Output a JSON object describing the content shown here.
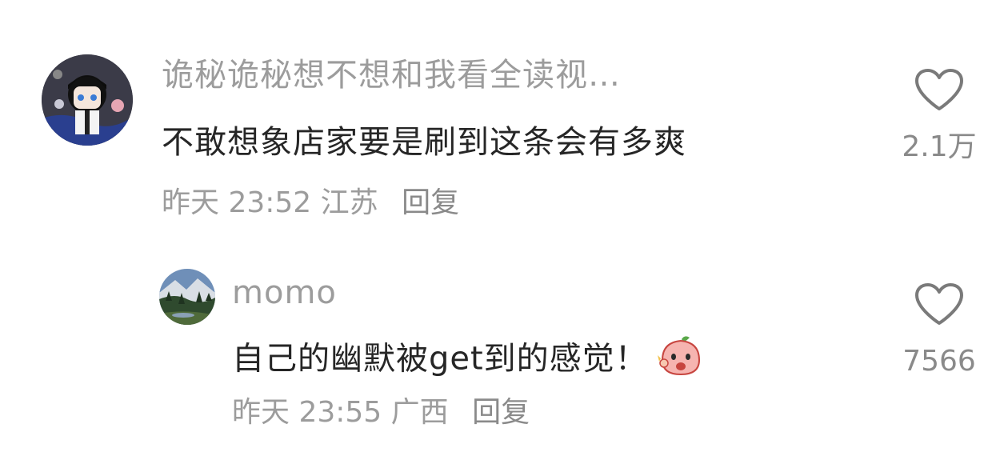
{
  "comments": [
    {
      "username": "诡秘诡秘想不想和我看全读视…",
      "content": "不敢想象店家要是刷到这条会有多爽",
      "time": "昨天 23:52",
      "location": "江苏",
      "reply_label": "回复",
      "like_count": "2.1万",
      "avatar_icon": "anime-character-avatar",
      "like_icon": "heart-outline-icon"
    },
    {
      "username": "momo",
      "content": "自己的幽默被get到的感觉！",
      "time": "昨天 23:55",
      "location": "广西",
      "reply_label": "回复",
      "like_count": "7566",
      "avatar_icon": "landscape-photo-avatar",
      "emoji_icon": "peach-emoji-icon",
      "like_icon": "heart-outline-icon"
    }
  ],
  "colors": {
    "username": "#9c9c9c",
    "content": "#262626",
    "meta": "#9c9c9c",
    "heart_stroke": "#7a7a7a"
  }
}
